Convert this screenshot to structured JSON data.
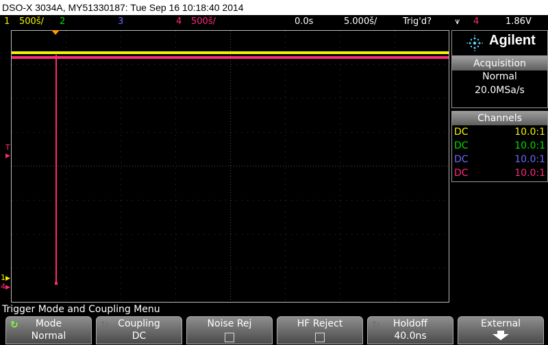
{
  "title": "DSO-X 3034A, MY51330187: Tue Sep 16 10:18:40 2014",
  "status": {
    "ch1_num": "1",
    "ch1_scale": "500š/",
    "ch2_num": "2",
    "ch3_num": "3",
    "ch4_num": "4",
    "ch4_scale": "500š/",
    "time_offset": "0.0s",
    "time_scale": "5.000š/",
    "trig_state": "Trig'd?",
    "trig_slope_icon": "⩛",
    "trig_source": "4",
    "trig_level": "1.86V"
  },
  "logo": {
    "brand": "Agilent",
    "icon": "agilent-spark-icon"
  },
  "acquisition": {
    "header": "Acquisition",
    "mode": "Normal",
    "rate": "20.0MSa/s"
  },
  "channels": {
    "header": "Channels",
    "rows": [
      {
        "coupling": "DC",
        "probe": "10.0:1",
        "color": "#f4f400"
      },
      {
        "coupling": "DC",
        "probe": "10.0:1",
        "color": "#00e000"
      },
      {
        "coupling": "DC",
        "probe": "10.0:1",
        "color": "#6a6aff"
      },
      {
        "coupling": "DC",
        "probe": "10.0:1",
        "color": "#ff2a7a"
      }
    ]
  },
  "markers": {
    "trigger_level": "T",
    "ch1_ground": "1",
    "ch4_ground": "4"
  },
  "menu": {
    "title": "Trigger Mode and Coupling Menu",
    "softkeys": [
      {
        "top": "Mode",
        "bottom": "Normal"
      },
      {
        "top": "Coupling",
        "bottom": "DC"
      },
      {
        "top": "Noise Rej",
        "bottom": ""
      },
      {
        "top": "HF Reject",
        "bottom": ""
      },
      {
        "top": "Holdoff",
        "bottom": "40.0ns"
      },
      {
        "top": "External",
        "bottom": ""
      }
    ]
  },
  "colors": {
    "ch1": "#f4f400",
    "ch2": "#00e000",
    "ch3": "#6a6aff",
    "ch4": "#ff2a7a",
    "trigger": "#ff9900"
  }
}
